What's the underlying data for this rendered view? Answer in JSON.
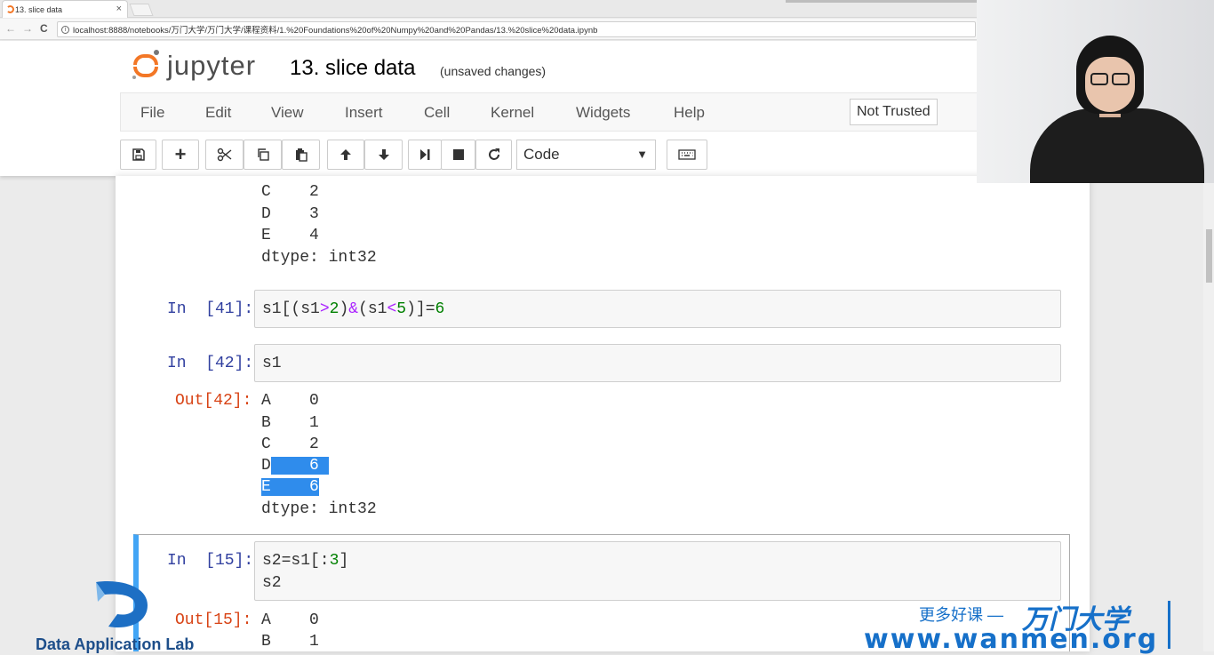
{
  "browser": {
    "tab_title": "13. slice data",
    "tab_close": "×",
    "url": "localhost:8888/notebooks/万门大学/万门大学/课程资料/1.%20Foundations%20of%20Numpy%20and%20Pandas/13.%20slice%20data.ipynb",
    "back": "←",
    "forward": "→",
    "reload": "C"
  },
  "header": {
    "logo_text": "jupyter",
    "notebook_title": "13. slice data",
    "save_status": "(unsaved changes)"
  },
  "menu": [
    "File",
    "Edit",
    "View",
    "Insert",
    "Cell",
    "Kernel",
    "Widgets",
    "Help"
  ],
  "trusted_label": "Not Trusted",
  "toolbar": {
    "cell_type": "Code",
    "cell_type_caret": "▼"
  },
  "notebook": {
    "prev_output": [
      "C    2",
      "D    3",
      "E    4",
      "dtype: int32"
    ],
    "cell41": {
      "prompt": "In  [41]:",
      "code_parts": [
        "s1[(s1",
        ">",
        "2",
        ")",
        "&",
        "(s1",
        "<",
        "5",
        ")]=",
        "6"
      ]
    },
    "cell42": {
      "prompt": "In  [42]:",
      "code": "s1",
      "out_prompt": "Out[42]:",
      "output": [
        {
          "idx": "A",
          "val": "0"
        },
        {
          "idx": "B",
          "val": "1"
        },
        {
          "idx": "C",
          "val": "2"
        },
        {
          "idx": "D",
          "val": "6"
        },
        {
          "idx": "E",
          "val": "6"
        }
      ],
      "dtype": "dtype: int32"
    },
    "cell15": {
      "prompt": "In  [15]:",
      "code_line1_parts": [
        "s2=s1[:",
        "3",
        "]"
      ],
      "code_line2": "s2",
      "out_prompt": "Out[15]:",
      "output": [
        {
          "idx": "A",
          "val": "0"
        },
        {
          "idx": "B",
          "val": "1"
        }
      ]
    }
  },
  "watermark": {
    "dal": "Data Application Lab",
    "tagline": "更多好课 —",
    "brand": "万门大学",
    "url": "www.wanmen.org"
  }
}
